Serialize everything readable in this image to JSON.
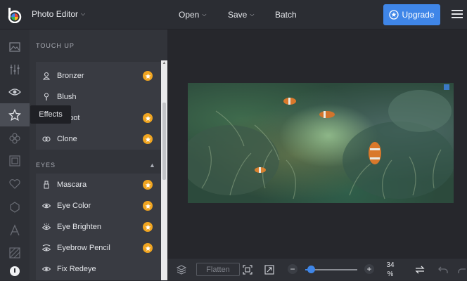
{
  "topbar": {
    "app_menu": "Photo Editor",
    "nav": [
      "Open",
      "Save",
      "Batch"
    ],
    "upgrade_label": "Upgrade"
  },
  "tooltip": "Effects",
  "panel": {
    "section_touchup": "TOUCH UP",
    "touchup_items": [
      {
        "label": "Bronzer",
        "icon": "person-icon",
        "premium": true
      },
      {
        "label": "Blush",
        "icon": "brush-icon",
        "premium": false
      },
      {
        "label": "shspot",
        "icon": "blemish-icon",
        "premium": true
      },
      {
        "label": "Clone",
        "icon": "clone-icon",
        "premium": true
      }
    ],
    "section_eyes": "EYES",
    "eyes_items": [
      {
        "label": "Mascara",
        "icon": "mascara-icon",
        "premium": true
      },
      {
        "label": "Eye Color",
        "icon": "eye-icon",
        "premium": true
      },
      {
        "label": "Eye Brighten",
        "icon": "eye-brighten-icon",
        "premium": true
      },
      {
        "label": "Eyebrow Pencil",
        "icon": "eyebrow-icon",
        "premium": true
      },
      {
        "label": "Fix Redeye",
        "icon": "eye-icon",
        "premium": false
      }
    ]
  },
  "bottombar": {
    "flatten_label": "Flatten",
    "zoom_value": "34",
    "zoom_unit": "%"
  },
  "colors": {
    "accent": "#3f86e8",
    "premium": "#f0a521"
  }
}
